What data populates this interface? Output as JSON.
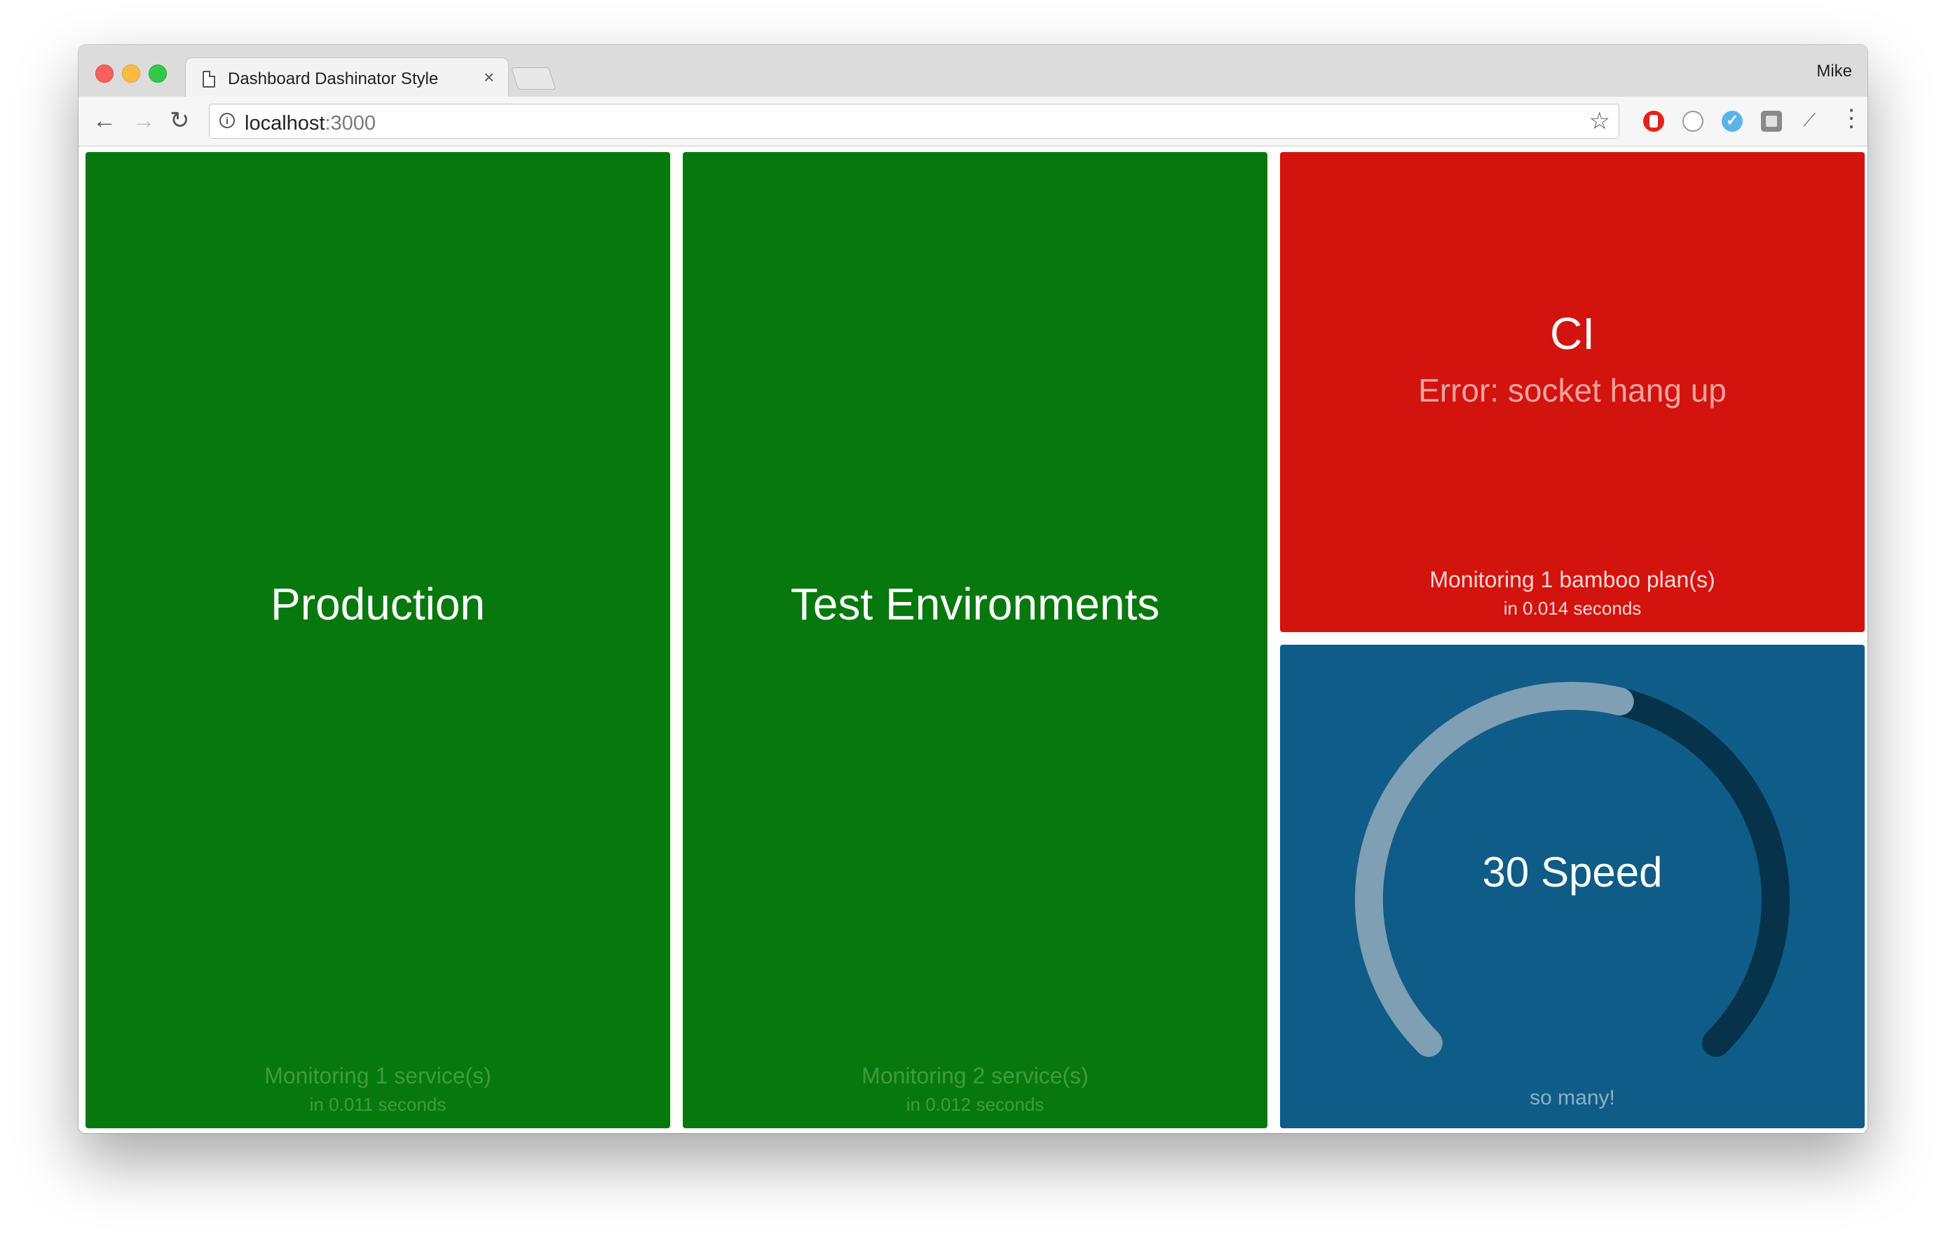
{
  "browser": {
    "tab_title": "Dashboard Dashinator Style",
    "tab_close": "×",
    "profile_name": "Mike",
    "url_host": "localhost",
    "url_port": ":3000",
    "icons": {
      "back": "←",
      "forward": "→",
      "reload": "↻",
      "info": "i",
      "star": "☆",
      "menu": "⋮"
    }
  },
  "dashboard": {
    "tiles": [
      {
        "title": "Production",
        "monitoring": "Monitoring 1 service(s)",
        "timing": "in 0.011 seconds",
        "status": "green"
      },
      {
        "title": "Test Environments",
        "monitoring": "Monitoring 2 service(s)",
        "timing": "in 0.012 seconds",
        "status": "green"
      },
      {
        "title": "CI",
        "error": "Error: socket hang up",
        "monitoring": "Monitoring 1 bamboo plan(s)",
        "timing": "in 0.014 seconds",
        "status": "red"
      }
    ],
    "gauge": {
      "value_label": "30 Speed",
      "caption": "so many!",
      "fraction": 0.55
    }
  },
  "colors": {
    "ok": "#07780e",
    "error": "#d3130e",
    "gauge_bg": "#0f5c88",
    "gauge_track": "#06324c",
    "gauge_fill": "#7f9fb4"
  }
}
